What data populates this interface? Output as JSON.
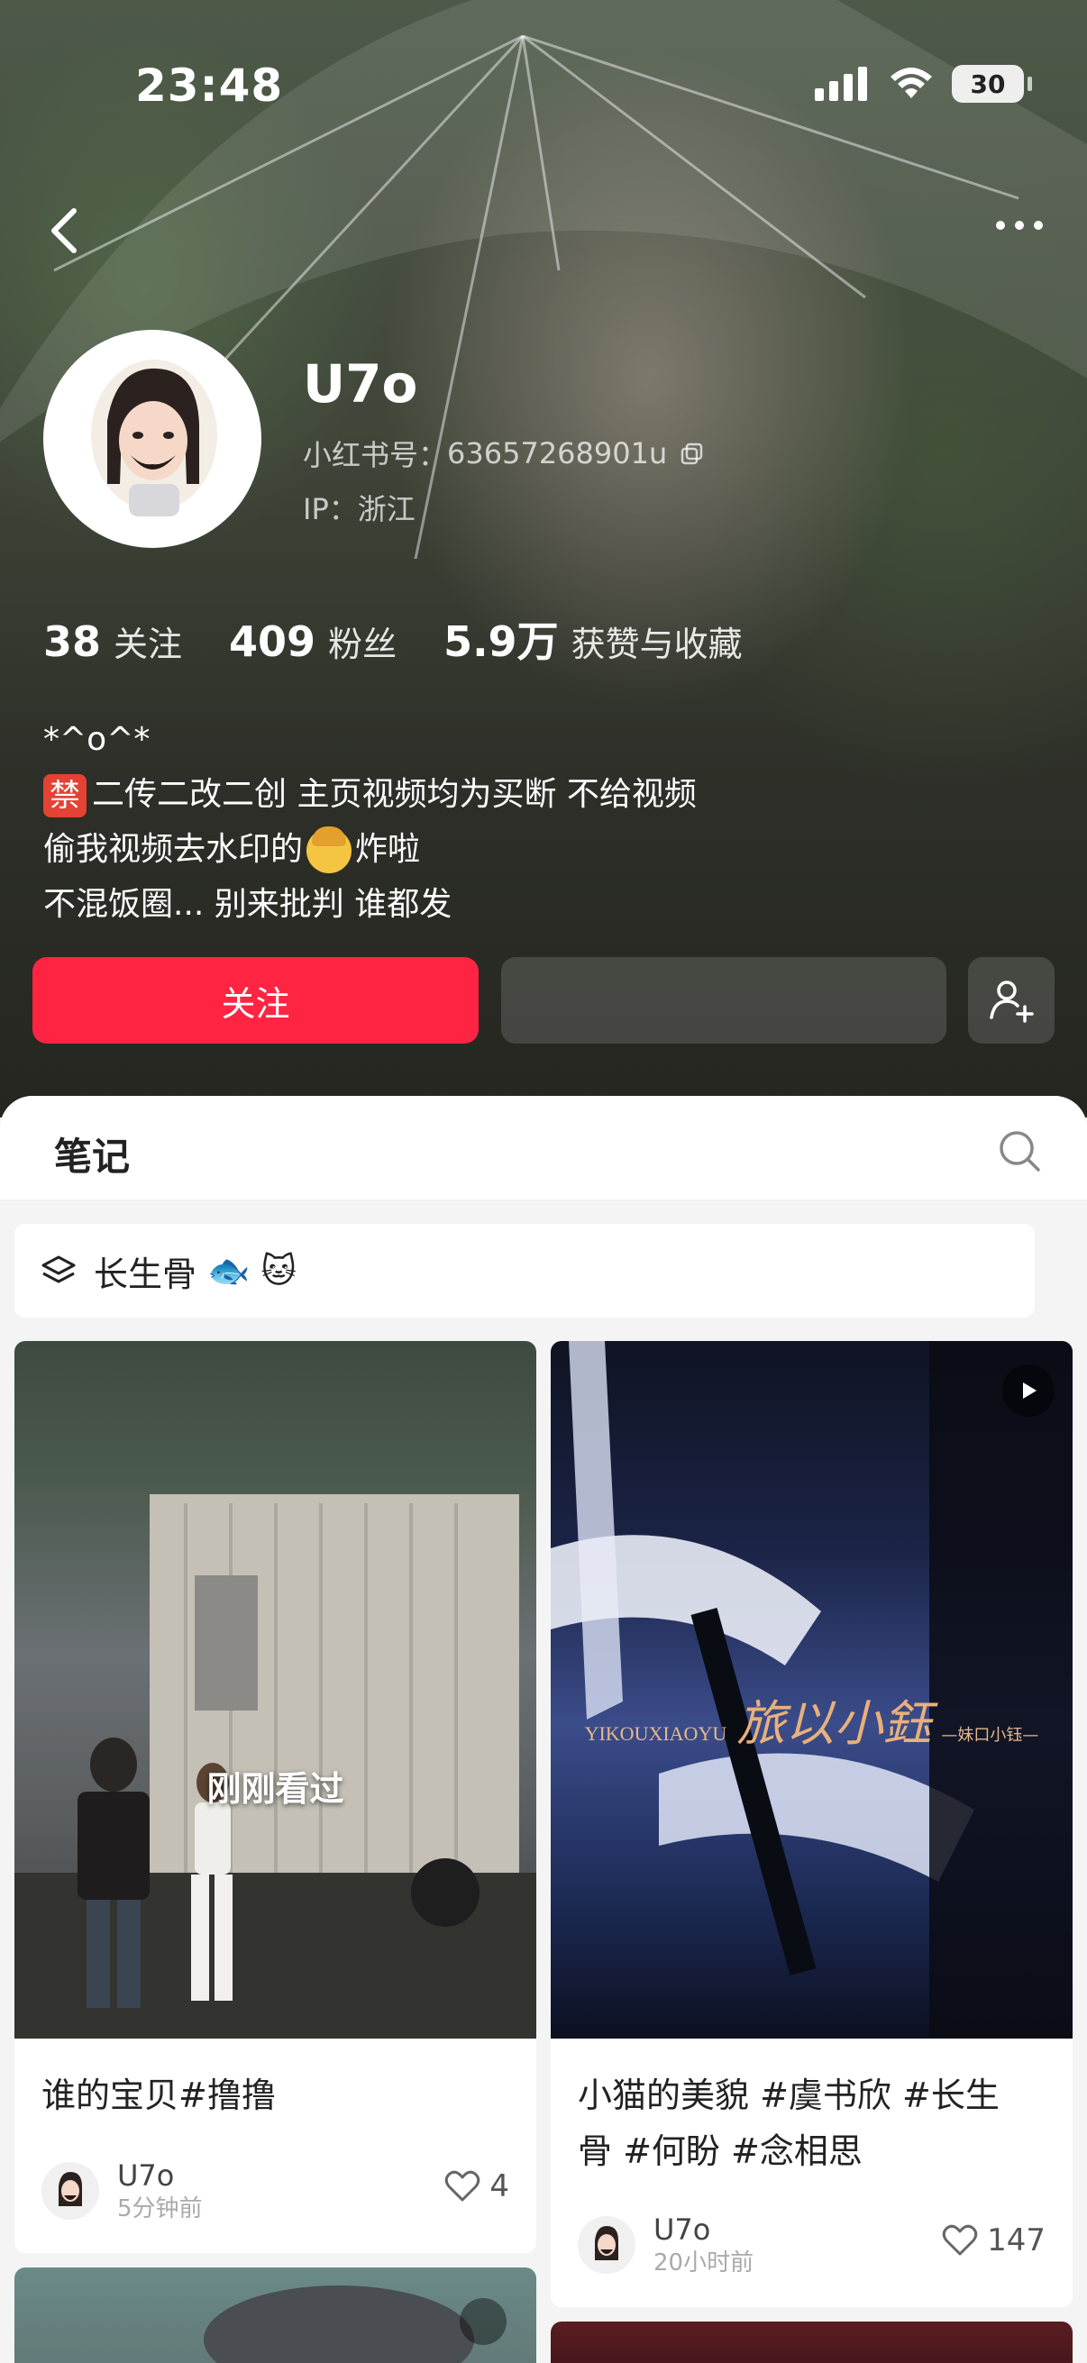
{
  "status": {
    "time": "23:48",
    "battery": "30"
  },
  "profile": {
    "username": "U7o",
    "red_id_label": "小红书号：",
    "red_id": "63657268901u",
    "ip_label": "IP：",
    "ip": "浙江"
  },
  "stats": {
    "following_num": "38",
    "following_label": "关注",
    "followers_num": "409",
    "followers_label": "粉丝",
    "likes_num": "5.9万",
    "likes_label": "获赞与收藏"
  },
  "bio": {
    "line1": "*^o^*",
    "ban_badge": "禁",
    "line2": "二传二改二创  主页视频均为买断 不给视频",
    "line3a": "偷我视频去水印的",
    "line3b": "炸啦",
    "line4": "不混饭圈... 别来批判 谁都发"
  },
  "actions": {
    "follow_label": "关注"
  },
  "tabs": {
    "notes_label": "笔记"
  },
  "collection": {
    "name": "长生骨",
    "emoji": "🐟 🐱"
  },
  "posts": [
    {
      "title": "谁的宝贝#撸撸",
      "overlay": "刚刚看过",
      "author": "U7o",
      "time": "5分钟前",
      "likes": "4"
    },
    {
      "title_line1": "小猫的美貌 #虞书欣 #长生",
      "title_line2": "骨 #何盼 #念相思",
      "watermark_cn": "旅以小鈺",
      "watermark_en": "YIKOUXIAOYU",
      "watermark_sub": "—妹口小钰—",
      "author": "U7o",
      "time": "20小时前",
      "likes": "147"
    }
  ],
  "colors": {
    "accent": "#ff2442"
  }
}
